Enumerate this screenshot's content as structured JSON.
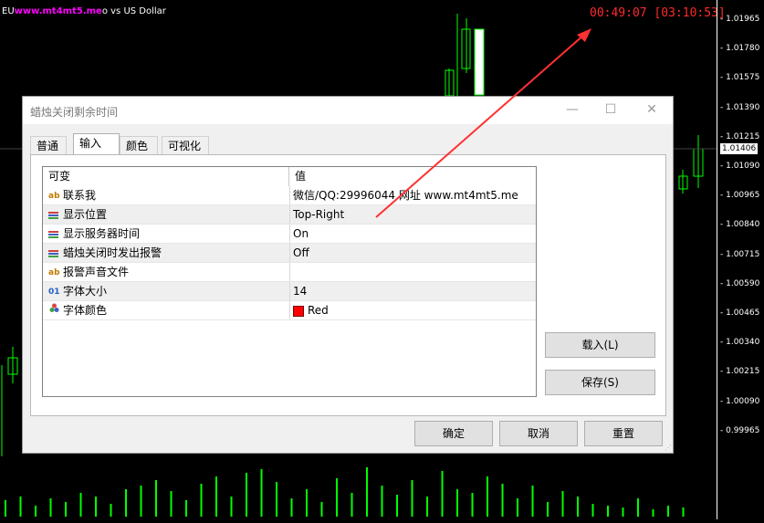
{
  "colors": {
    "timer": "#ff2a2a",
    "arrow": "#ff3030",
    "bull": "#00ff00",
    "watermark": "#ff00ff"
  },
  "chart": {
    "symbol_prefix": "EU",
    "watermark": "www.mt4mt5.me",
    "symbol_text": "o vs US Dollar",
    "timer": "00:49:07 [03:10:53]",
    "current_price": "1.01406",
    "price_labels": [
      "1.01965",
      "1.01780",
      "1.01575",
      "1.01390",
      "1.01210",
      "1.01090",
      "1.00965",
      "1.00840",
      "1.00715",
      "1.00590",
      "1.00465",
      "1.00340",
      "1.00215",
      "1.00090",
      "0.99965"
    ],
    "price_labels_display": [
      "1.01965",
      "1.01780",
      "1.01575",
      "1.01390",
      "1.01215",
      "1.01090",
      "1.00965",
      "1.00840",
      "1.00715",
      "1.00590",
      "1.00465",
      "1.00340",
      "1.00215",
      "1.00090",
      "0.99965"
    ]
  },
  "dialog": {
    "title": "蜡烛关闭剩余时间",
    "minimize": "—",
    "maximize": "☐",
    "close": "✕",
    "tabs": [
      {
        "label": "普通"
      },
      {
        "label": "输入"
      },
      {
        "label": "颜色"
      },
      {
        "label": "可视化"
      }
    ],
    "grid": {
      "col_name": "可变",
      "col_value": "值",
      "rows": [
        {
          "icon": "ab",
          "name": "联系我",
          "value": "微信/QQ:29996044 网址 www.mt4mt5.me"
        },
        {
          "icon": "enum",
          "name": "显示位置",
          "value": "Top-Right"
        },
        {
          "icon": "enum",
          "name": "显示服务器时间",
          "value": "On"
        },
        {
          "icon": "enum",
          "name": "蜡烛关闭时发出报警",
          "value": "Off"
        },
        {
          "icon": "ab",
          "name": "报警声音文件",
          "value": ""
        },
        {
          "icon": "01",
          "name": "字体大小",
          "value": "14"
        },
        {
          "icon": "color",
          "name": "字体颜色",
          "value": "Red"
        }
      ]
    },
    "load_button": "载入(L)",
    "save_button": "保存(S)",
    "ok_button": "确定",
    "cancel_button": "取消",
    "reset_button": "重置"
  }
}
